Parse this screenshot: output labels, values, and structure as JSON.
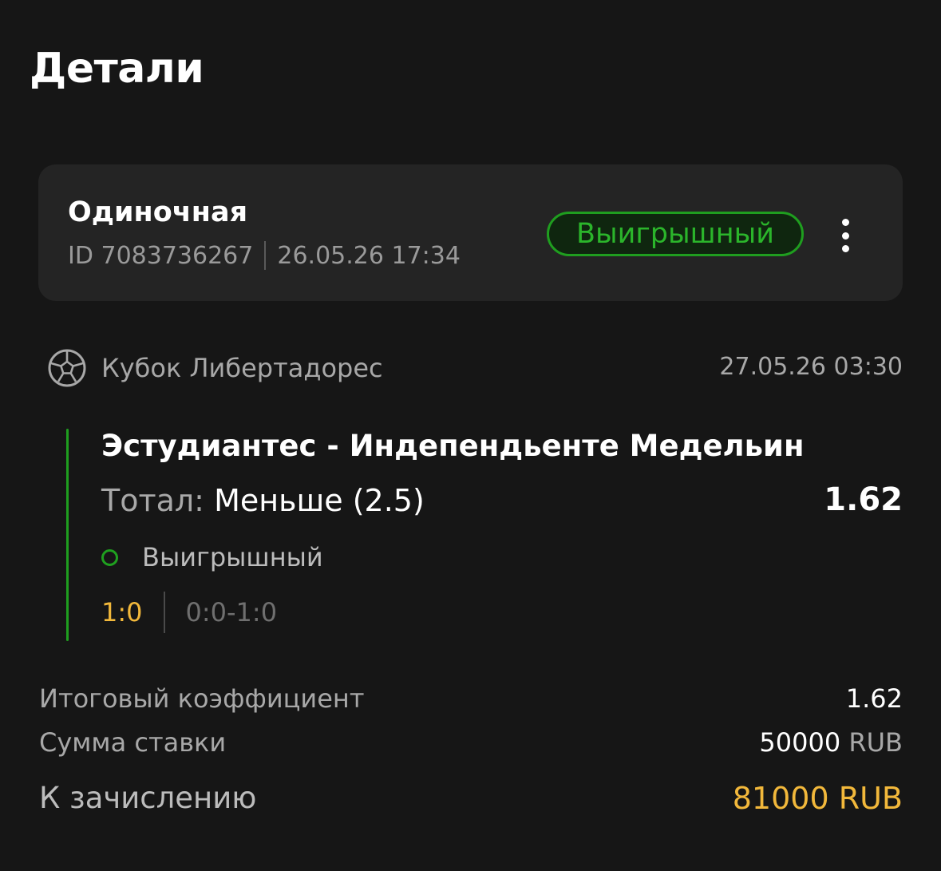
{
  "page": {
    "title": "Детали"
  },
  "bet": {
    "type": "Одиночная",
    "id_text": "ID 7083736267",
    "placed_at": "26.05.26 17:34",
    "status": "Выигрышный",
    "more_icon": "more-vertical-icon"
  },
  "event": {
    "sport_icon": "soccer-ball-icon",
    "league": "Кубок Либертадорес",
    "date": "27.05.26 03:30",
    "match": "Эстудиантес - Индепендьенте Медельин",
    "market_label": "Тотал:",
    "market_value": "Меньше (2.5)",
    "odds": "1.62",
    "result": "Выигрышный",
    "score_final": "1:0",
    "score_periods": "0:0-1:0"
  },
  "summary": {
    "total_odds_label": "Итоговый коэффициент",
    "total_odds_value": "1.62",
    "stake_label": "Сумма ставки",
    "stake_amount": "50000",
    "stake_currency": "RUB",
    "payout_label": "К зачислению",
    "payout_value": "81000 RUB"
  },
  "colors": {
    "background": "#161616",
    "card": "#242424",
    "win_green": "#1f9e1f",
    "accent_yellow": "#f2b83b"
  }
}
